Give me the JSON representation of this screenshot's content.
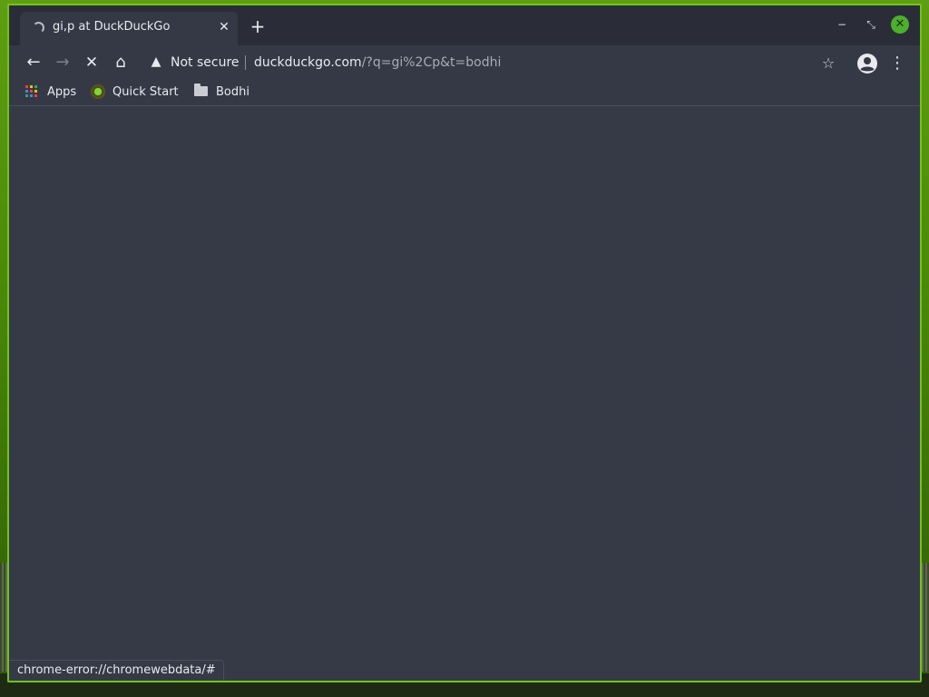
{
  "tab": {
    "title": "gi,p at DuckDuckGo",
    "close_glyph": "✕"
  },
  "new_tab_glyph": "+",
  "window_controls": {
    "minimize_glyph": "−",
    "maximize_glyph": "⤡",
    "close_glyph": "✕"
  },
  "toolbar": {
    "back_glyph": "←",
    "forward_glyph": "→",
    "stop_glyph": "✕",
    "home_glyph": "⌂",
    "security_label": "Not secure",
    "warning_glyph": "▲",
    "url_host": "duckduckgo.com",
    "url_path": "/?q=gi%2Cp&t=bodhi",
    "star_glyph": "☆",
    "menu_glyph": "⋮"
  },
  "bookmarks": {
    "items": [
      {
        "label": "Apps",
        "icon": "apps-grid-icon"
      },
      {
        "label": "Quick Start",
        "icon": "bodhi-logo-icon"
      },
      {
        "label": "Bodhi",
        "icon": "folder-icon"
      }
    ]
  },
  "status_bar": {
    "text": "chrome-error://chromewebdata/#"
  },
  "colors": {
    "window_border": "#6fc41a",
    "content_bg": "#363a47",
    "titlebar_bg": "#2a2d38",
    "close_button": "#4caf2d"
  }
}
